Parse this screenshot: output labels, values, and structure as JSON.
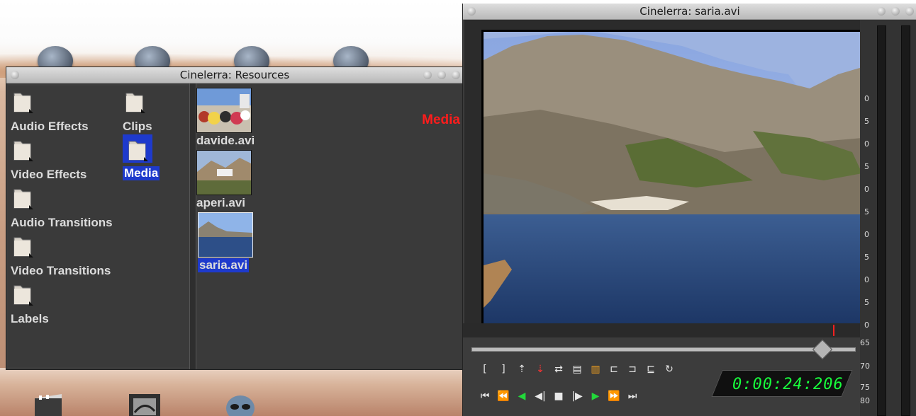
{
  "resources": {
    "title": "Cinelerra: Resources",
    "media_heading": "Media",
    "folders": [
      {
        "label": "Audio Effects"
      },
      {
        "label": "Clips"
      },
      {
        "label": "Video Effects"
      },
      {
        "label": "Media",
        "selected": true
      },
      {
        "label": "Audio Transitions"
      },
      {
        "label": "Video Transitions"
      },
      {
        "label": "Labels"
      }
    ],
    "assets": [
      {
        "label": "davide.avi"
      },
      {
        "label": "aperi.avi"
      },
      {
        "label": "saria.avi",
        "selected": true
      }
    ]
  },
  "viewer": {
    "title": "Cinelerra: saria.avi",
    "timecode": "0:00:24:206",
    "meter_labels": [
      "5",
      "0",
      "5",
      "0",
      "5",
      "0",
      "5",
      "0",
      "5",
      "0",
      "65",
      "70",
      "75",
      "80"
    ]
  },
  "colors": {
    "selection": "#1e3acc",
    "media_heading": "#ff1c1c",
    "timecode": "#18ff3c",
    "transport_green": "#22d83a"
  }
}
